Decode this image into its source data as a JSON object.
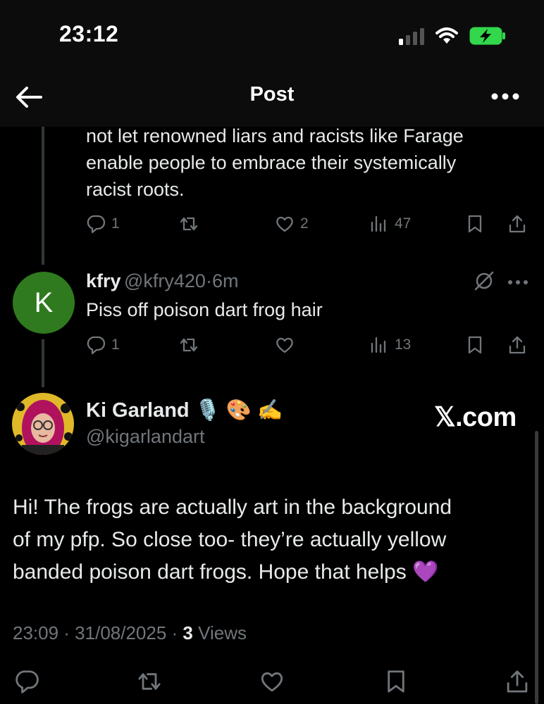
{
  "status_bar": {
    "time": "23:12"
  },
  "header": {
    "title": "Post"
  },
  "parent_post": {
    "text_lines": [
      "not let renowned liars and racists like Farage",
      "enable people to embrace their systemically",
      "racist roots."
    ],
    "replies": "1",
    "likes": "2",
    "views": "47"
  },
  "kfry_reply": {
    "avatar_letter": "K",
    "name": "kfry",
    "handle": "@kfry420",
    "separator": "·",
    "time": "6m",
    "text": "Piss off poison dart frog hair",
    "replies": "1",
    "views": "13"
  },
  "main_post": {
    "name": "Ki Garland",
    "emojis": "🎙️ 🎨 ✍️",
    "handle": "@kigarlandart",
    "text_lines": [
      "Hi! The frogs are actually art in the background",
      "of my pfp. So close too- they’re actually yellow",
      "banded poison dart frogs. Hope that helps 💜"
    ],
    "timestamp": "23:09 · 31/08/2025 ·",
    "view_count": "3",
    "views_label": "Views"
  },
  "watermark": "𝕏.com",
  "colors": {
    "background": "#000000",
    "text": "#e7e9ea",
    "muted": "#71767b",
    "avatar_k": "#2f7a1e"
  }
}
